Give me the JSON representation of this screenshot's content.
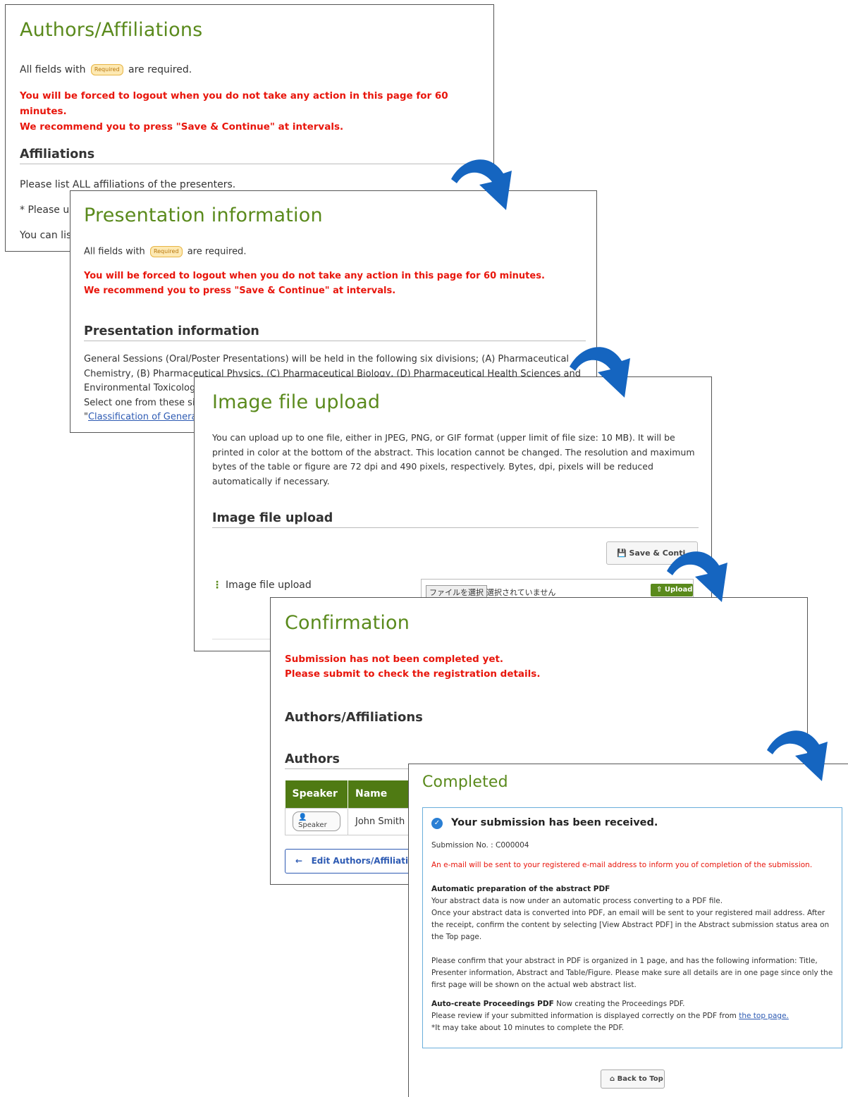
{
  "required_badge": "Required",
  "panel1": {
    "title": "Authors/Affiliations",
    "req_prefix": "All fields with",
    "req_suffix": "are required.",
    "warn1": "You will be forced to logout when you do not take any action in this page for 60 minutes.",
    "warn2": "We recommend you to press \"Save & Continue\" at intervals.",
    "section": "Affiliations",
    "line1": "Please list ALL affiliations of the presenters.",
    "line2": "* Please us",
    "line3": "You can lis"
  },
  "panel2": {
    "title": "Presentation information",
    "req_prefix": "All fields with",
    "req_suffix": "are required.",
    "warn1": "You will be forced to logout when you do not take any action in this page for 60 minutes.",
    "warn2": "We recommend you to press \"Save & Continue\" at intervals.",
    "section": "Presentation information",
    "body_line1": "General Sessions (Oral/Poster Presentations) will be held in the following six divisions; (A) Pharmaceutical",
    "body_line2": "Chemistry, (B) Pharmaceutical Physics, (C) Pharmaceutical Biology, (D) Pharmaceutical Health Sciences and",
    "body_line3": "Environmental Toxicolog",
    "body_line4": "Select one from these six",
    "link_quote": "\"",
    "link_text": "Classification of Genera"
  },
  "panel3": {
    "title": "Image file upload",
    "body": "You can upload up to one file, either in JPEG, PNG, or GIF format (upper limit of file size: 10 MB). It will be printed in color at the bottom of the abstract. This location cannot be changed. The resolution and maximum bytes of the table or figure are 72 dpi and 490 pixels, respectively. Bytes, dpi, pixels will be reduced automatically if necessary.",
    "section": "Image file upload",
    "save_label": "Save & Conti",
    "field_label": "Image file upload",
    "choose_file": "ファイルを選択",
    "no_file": "選択されていません",
    "upload_label": "Upload"
  },
  "panel4": {
    "title": "Confirmation",
    "warn1": "Submission has not been completed yet.",
    "warn2": "Please submit to check the registration details.",
    "subheading": "Authors/Affiliations",
    "section": "Authors",
    "table": {
      "headers": [
        "Speaker",
        "Name"
      ],
      "rows": [
        {
          "speaker_badge": "Speaker",
          "name": "John Smith"
        }
      ]
    },
    "edit_label": "Edit Authors/Affiliation"
  },
  "panel5": {
    "title": "Completed",
    "received": "Your submission has been received.",
    "submission_no": "Submission No. : C000004",
    "email_note": "An e-mail will be sent to your registered e-mail address to inform you of completion of the submission.",
    "auto_pdf_heading": "Automatic preparation of the abstract PDF",
    "auto_pdf_line1": "Your abstract data is now under an automatic process converting to a PDF file.",
    "auto_pdf_line2": "Once your abstract data is converted into PDF, an email will be sent to your registered mail address. After the receipt, confirm the content by selecting [View Abstract PDF] in the Abstract submission status area on the Top page.",
    "confirm_text": "Please confirm that your abstract in PDF is organized in 1 page, and has the following information: Title, Presenter information, Abstract and Table/Figure. Please make sure all details are in one page since only the first page will be shown on the actual web abstract list.",
    "proc_heading": "Auto-create Proceedings PDF",
    "proc_text": "Now creating the Proceedings PDF.",
    "proc_line2": "Please review if your submitted information is displayed correctly on the PDF from",
    "proc_link": "the top page.",
    "proc_note": "*It may take about 10 minutes to complete the PDF.",
    "back_label": "Back to Top"
  },
  "colors": {
    "title_green": "#5a8a1c",
    "warning_red": "#e8160c",
    "arrow_blue": "#1565c0",
    "table_header_green": "#4f7a13"
  }
}
